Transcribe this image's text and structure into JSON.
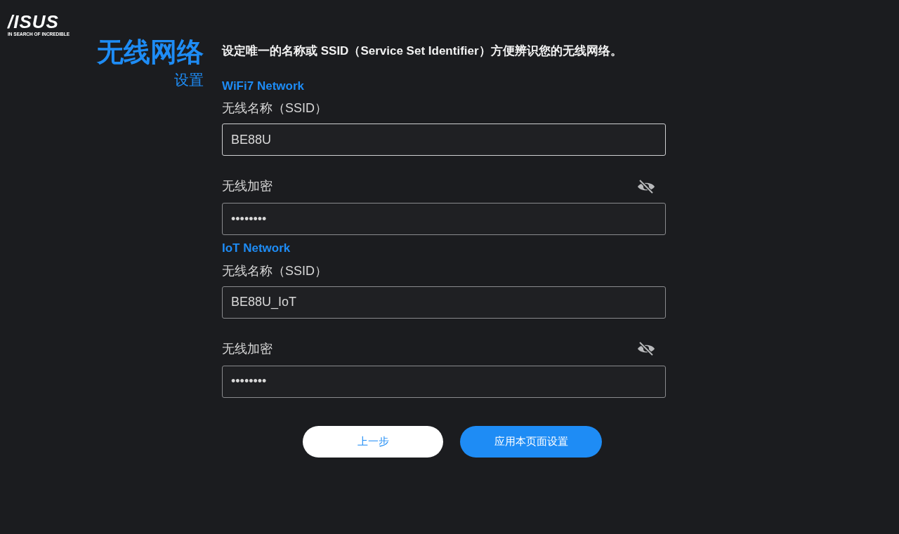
{
  "logo": {
    "brand": "/ISUS",
    "tagline": "IN SEARCH OF INCREDIBLE"
  },
  "title": {
    "main": "无线网络",
    "sub": "设置"
  },
  "description": "设定唯一的名称或 SSID（Service Set Identifier）方便辨识您的无线网络。",
  "sections": [
    {
      "heading": "WiFi7 Network",
      "ssid_label": "无线名称（SSID）",
      "ssid_value": "BE88U",
      "ssid_focused": true,
      "password_label": "无线加密",
      "password_value": "••••••••",
      "password_revealed": false
    },
    {
      "heading": "IoT Network",
      "ssid_label": "无线名称（SSID）",
      "ssid_value": "BE88U_IoT",
      "ssid_focused": false,
      "password_label": "无线加密",
      "password_value": "••••••••",
      "password_revealed": false
    }
  ],
  "buttons": [
    {
      "label": "上一步",
      "kind": "secondary"
    },
    {
      "label": "应用本页面设置",
      "kind": "primary"
    }
  ]
}
